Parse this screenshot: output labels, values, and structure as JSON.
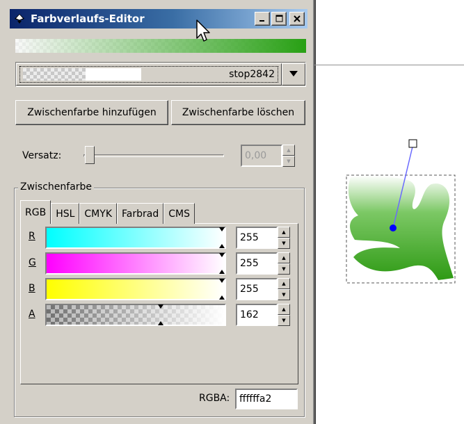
{
  "window": {
    "title": "Farbverlaufs-Editor",
    "icon": "inkscape-icon",
    "controls": [
      "minimize-icon",
      "maximize-icon",
      "close-icon"
    ]
  },
  "stop_selector": {
    "selected": "stop2842"
  },
  "buttons": {
    "add_stop": "Zwischenfarbe hinzufügen",
    "delete_stop": "Zwischenfarbe löschen"
  },
  "offset": {
    "label": "Versatz:",
    "value": "0,00",
    "slider_fraction": 0.0
  },
  "stop_color_group": {
    "title": "Zwischenfarbe",
    "tabs": [
      "RGB",
      "HSL",
      "CMYK",
      "Farbrad",
      "CMS"
    ],
    "active_tab": "RGB",
    "channels": [
      {
        "key": "R",
        "value": "255",
        "color": "#00ffff"
      },
      {
        "key": "G",
        "value": "255",
        "color": "#ff00ff"
      },
      {
        "key": "B",
        "value": "255",
        "color": "#ffff00"
      },
      {
        "key": "A",
        "value": "162",
        "color": "#ffffff"
      }
    ],
    "rgba_label": "RGBA:",
    "rgba_value": "ffffffa2"
  },
  "colors": {
    "titlebar_start": "#0a246a",
    "gradient_end": "#28a014",
    "leaf_green": "#3aa622",
    "handle_blue": "#0000ff"
  }
}
